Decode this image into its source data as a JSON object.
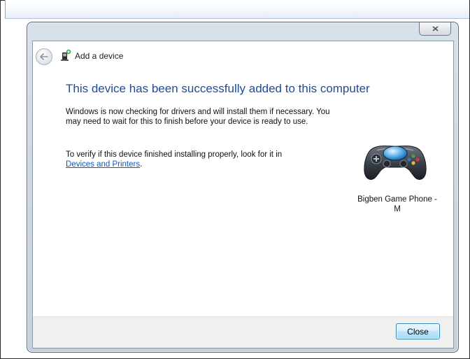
{
  "dialog": {
    "title": "Add a device",
    "heading": "This device has been successfully added to this computer",
    "paragraph1": "Windows is now checking for drivers and will install them if necessary. You may need to wait for this to finish before your device is ready to use.",
    "paragraph2_prefix": "To verify if this device finished installing properly, look for it in",
    "link_label": "Devices and Printers",
    "paragraph2_suffix": ".",
    "device_name": "Bigben Game Phone -M",
    "close_button_label": "Close"
  },
  "icons": {
    "back": "back-arrow-icon",
    "wizard": "add-device-icon",
    "device": "gamepad-icon",
    "window_close": "close-icon"
  },
  "colors": {
    "heading": "#1f4b99",
    "link": "#0b57c9",
    "button_border": "#3c7fb1"
  }
}
